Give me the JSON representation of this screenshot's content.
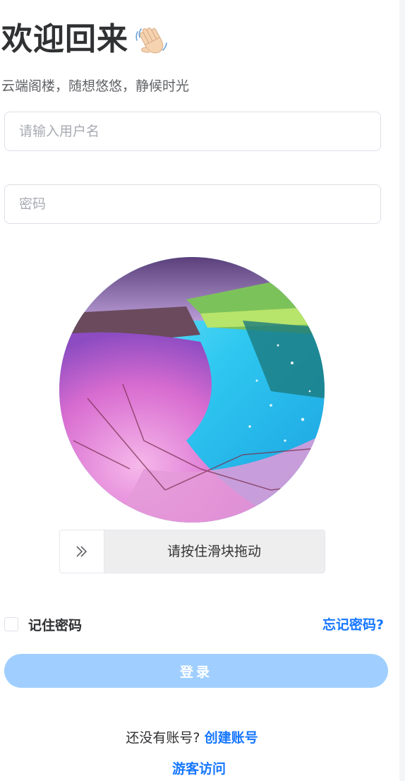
{
  "header": {
    "title": "欢迎回来",
    "wave_icon": "waving-hand-icon",
    "subtitle": "云端阁楼，随想悠悠，静候时光"
  },
  "form": {
    "username_placeholder": "请输入用户名",
    "username_value": "",
    "password_placeholder": "密码",
    "password_value": ""
  },
  "captcha": {
    "image_icon": "cherry-blossom-river-picture",
    "slider_icon": "double-chevron-right-icon",
    "slider_text": "请按住滑块拖动"
  },
  "options": {
    "remember_label": "记住密码",
    "remember_checked": false,
    "forgot_label": "忘记密码?"
  },
  "actions": {
    "login_label": "登录"
  },
  "footer": {
    "no_account_text": "还没有账号?",
    "register_label": "创建账号",
    "guest_label": "游客访问"
  },
  "colors": {
    "accent": "#1677ff",
    "login_button": "#a0cfff",
    "title": "#303133"
  }
}
